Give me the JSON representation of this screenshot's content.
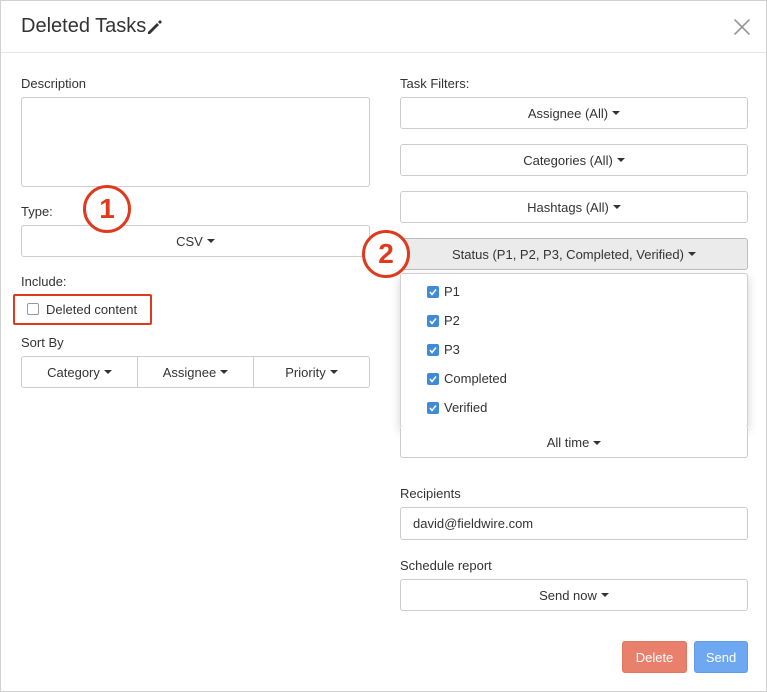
{
  "header": {
    "title": "Deleted Tasks",
    "edit_icon": "pencil-icon",
    "close_icon": "close-icon"
  },
  "left": {
    "description_label": "Description",
    "description_value": "",
    "type_label": "Type:",
    "type_value": "CSV",
    "include_label": "Include:",
    "deleted_content_label": "Deleted content",
    "deleted_content_checked": false,
    "sort_by_label": "Sort By",
    "sort_buttons": [
      "Category",
      "Assignee",
      "Priority"
    ]
  },
  "right": {
    "task_filters_label": "Task Filters:",
    "assignee_filter": "Assignee (All)",
    "categories_filter": "Categories (All)",
    "hashtags_filter": "Hashtags (All)",
    "status_filter": "Status (P1, P2, P3, Completed, Verified)",
    "status_options": [
      {
        "label": "P1",
        "checked": true
      },
      {
        "label": "P2",
        "checked": true
      },
      {
        "label": "P3",
        "checked": true
      },
      {
        "label": "Completed",
        "checked": true
      },
      {
        "label": "Verified",
        "checked": true
      }
    ],
    "time_filter": "All time",
    "recipients_label": "Recipients",
    "recipients_value": "david@fieldwire.com",
    "schedule_label": "Schedule report",
    "schedule_value": "Send now"
  },
  "annotations": {
    "badge_1": "1",
    "badge_2": "2",
    "color": "#e03a1e"
  },
  "footer": {
    "delete_label": "Delete",
    "send_label": "Send"
  },
  "colors": {
    "checkbox_blue": "#3d8bd9",
    "delete_bg": "#e8806b",
    "send_bg": "#6ea8f0"
  }
}
